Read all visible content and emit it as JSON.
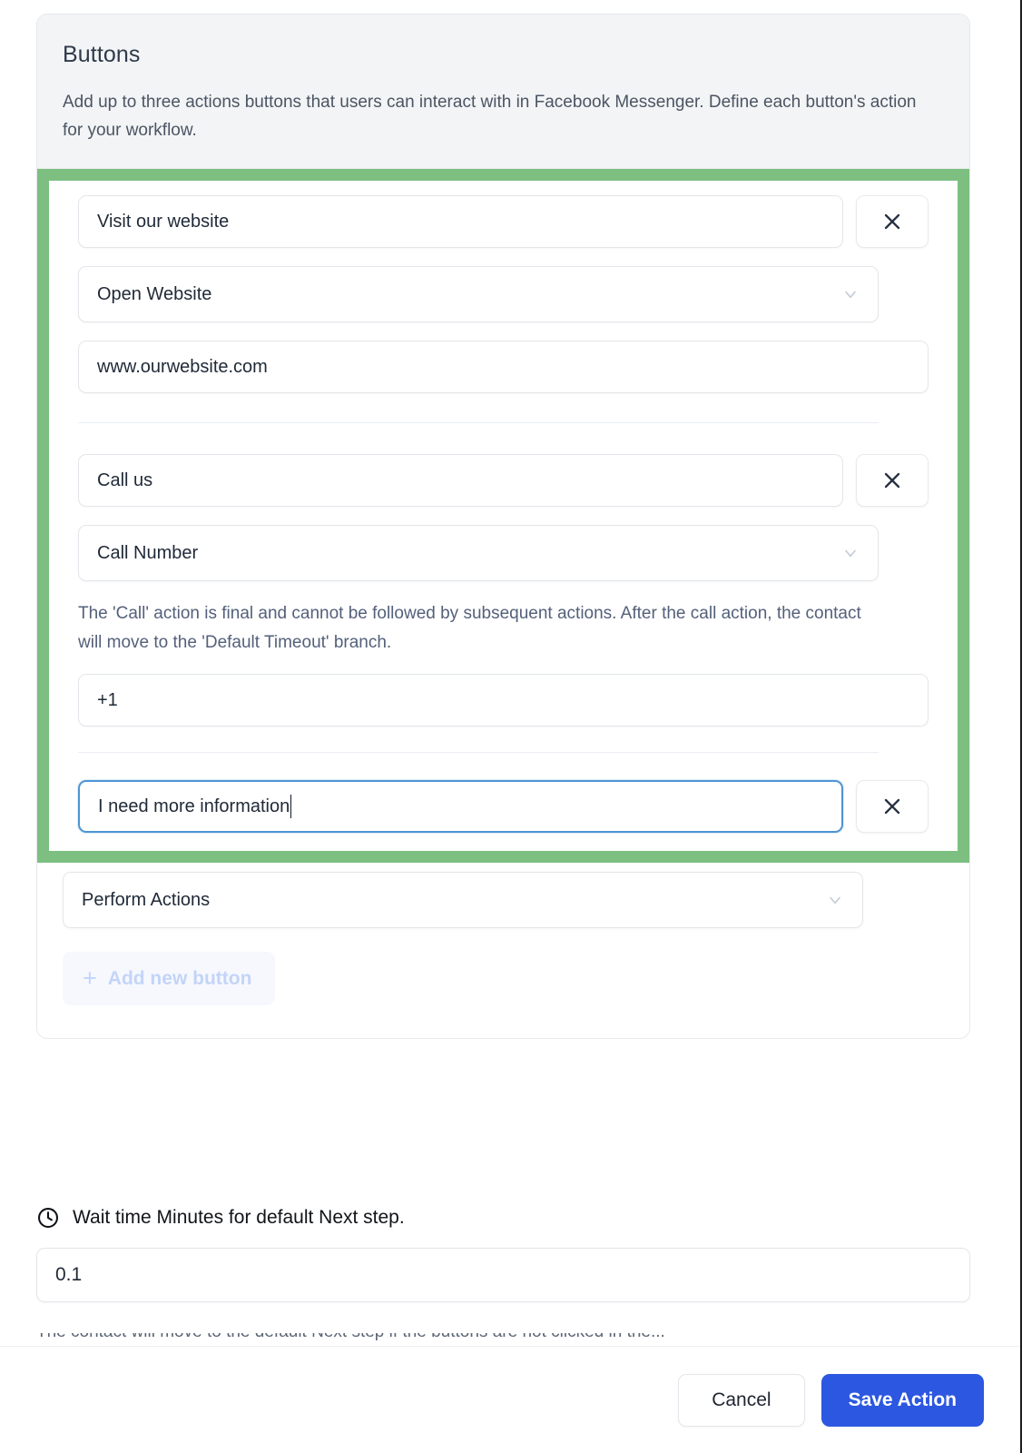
{
  "panel": {
    "title": "Buttons",
    "description": "Add up to three actions buttons that users can interact with in Facebook Messenger. Define each button's action for your workflow."
  },
  "highlight_color": "#7cbf80",
  "accent_color": "#2c57e0",
  "focus_color": "#4e95d4",
  "buttons": [
    {
      "label_value": "Visit our website",
      "action_value": "Open Website",
      "extra_value": "www.ourwebsite.com",
      "remove_icon": "close-icon",
      "chevron_icon": "chevron-down-icon",
      "note": ""
    },
    {
      "label_value": "Call us",
      "action_value": "Call Number",
      "extra_value": "+1",
      "remove_icon": "close-icon",
      "chevron_icon": "chevron-down-icon",
      "note": "The 'Call' action is final and cannot be followed by subsequent actions. After the call action, the contact will move to the 'Default Timeout' branch."
    },
    {
      "label_value": "I need more information",
      "action_value": "Perform Actions",
      "extra_value": "",
      "remove_icon": "close-icon",
      "chevron_icon": "chevron-down-icon",
      "note": ""
    }
  ],
  "add_button": {
    "label": "Add new button",
    "plus_icon": "plus-icon",
    "disabled": true
  },
  "wait_time": {
    "icon": "clock-icon",
    "label": "Wait time Minutes for default Next step.",
    "value": "0.1"
  },
  "clipped_hint": "The contact will move to the default Next step if the buttons are not clicked in the...",
  "footer": {
    "cancel_label": "Cancel",
    "save_label": "Save Action"
  }
}
